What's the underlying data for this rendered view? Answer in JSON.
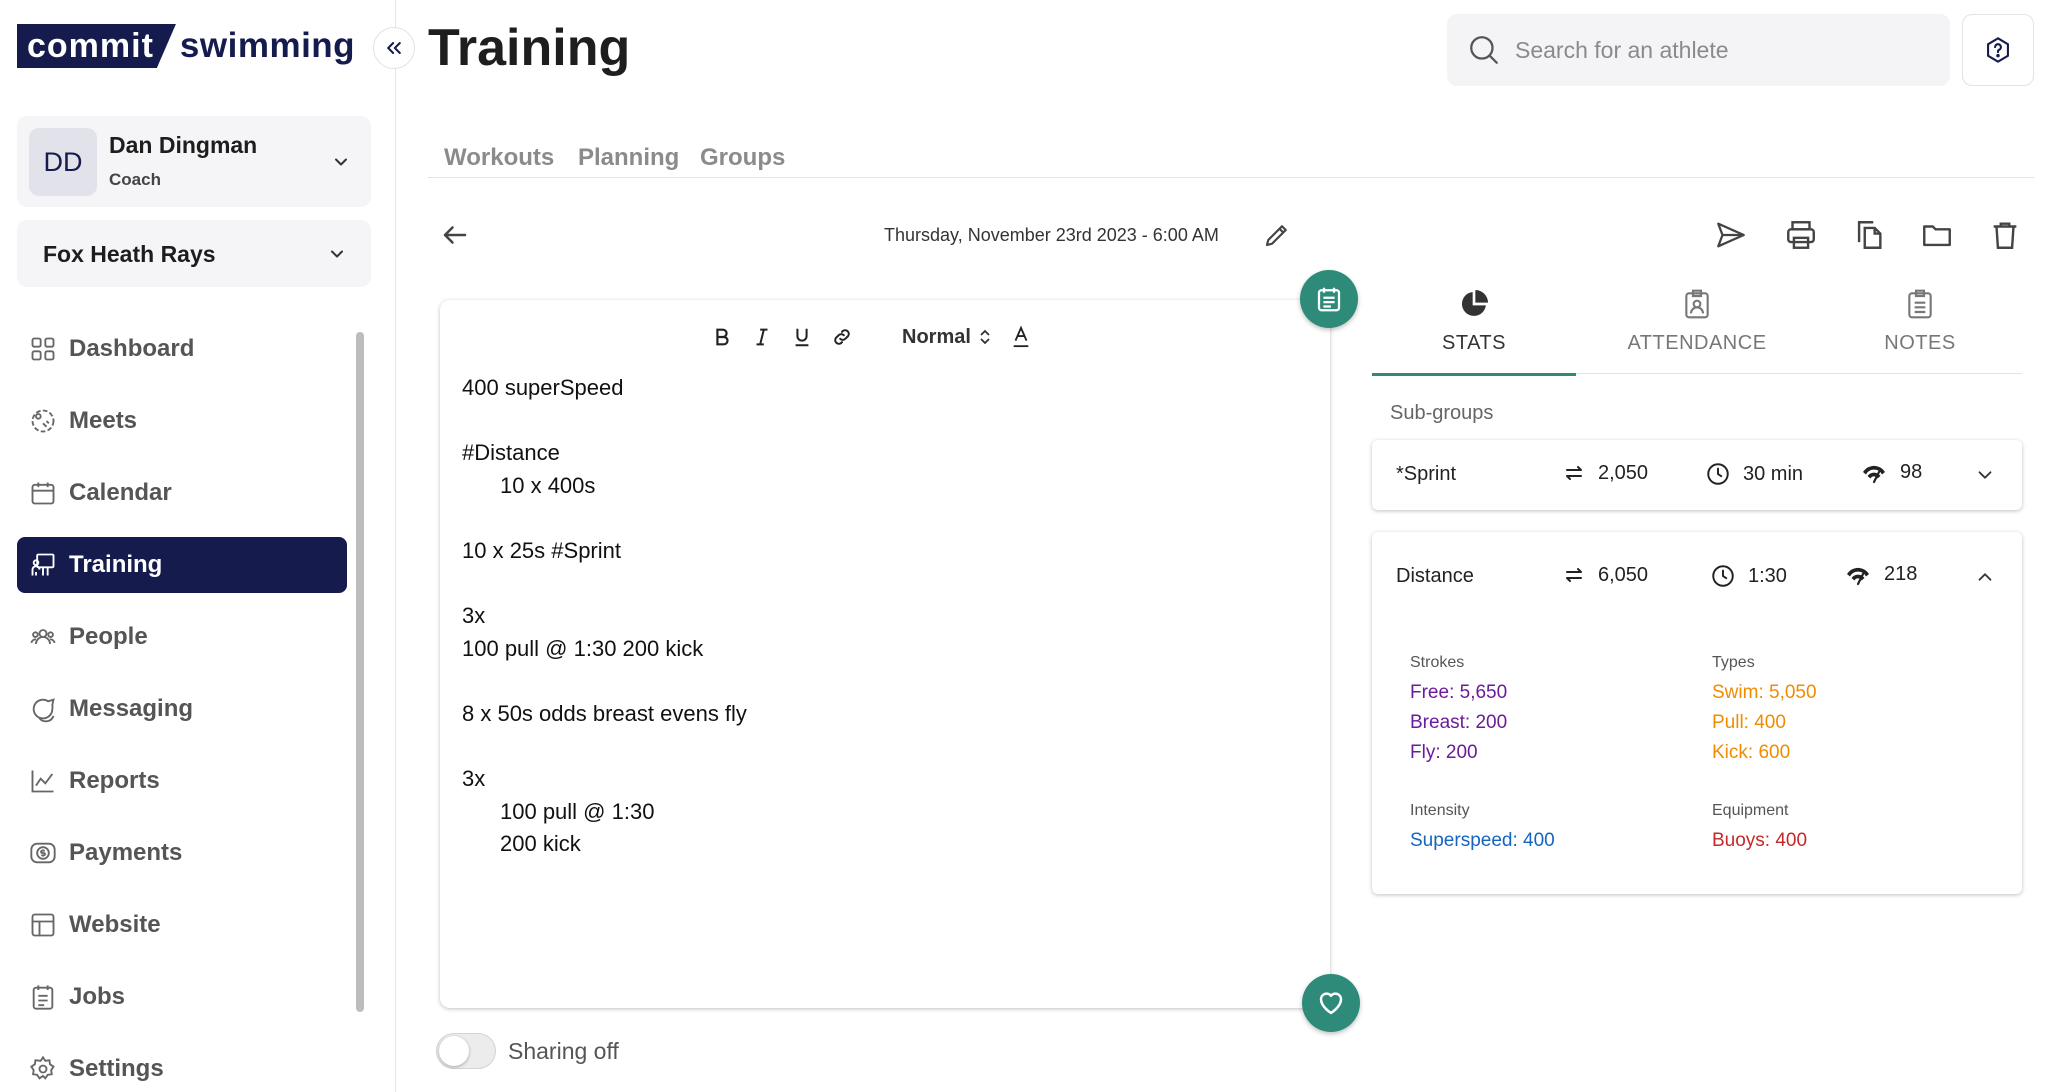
{
  "app": {
    "logo_left": "commit",
    "logo_right": "swimming",
    "page_title": "Training"
  },
  "user": {
    "initials": "DD",
    "name": "Dan Dingman",
    "role": "Coach"
  },
  "team": {
    "name": "Fox Heath Rays"
  },
  "nav": {
    "items": [
      {
        "label": "Dashboard",
        "icon": "dashboard-icon"
      },
      {
        "label": "Meets",
        "icon": "meets-icon"
      },
      {
        "label": "Calendar",
        "icon": "calendar-icon"
      },
      {
        "label": "Training",
        "icon": "training-icon",
        "active": true
      },
      {
        "label": "People",
        "icon": "people-icon"
      },
      {
        "label": "Messaging",
        "icon": "messaging-icon"
      },
      {
        "label": "Reports",
        "icon": "reports-icon"
      },
      {
        "label": "Payments",
        "icon": "payments-icon"
      },
      {
        "label": "Website",
        "icon": "website-icon"
      },
      {
        "label": "Jobs",
        "icon": "jobs-icon"
      },
      {
        "label": "Settings",
        "icon": "settings-icon"
      }
    ]
  },
  "search": {
    "placeholder": "Search for an athlete"
  },
  "tabs": {
    "workouts": "Workouts",
    "planning": "Planning",
    "groups": "Groups"
  },
  "workout": {
    "date": "Thursday, November 23rd 2023 - 6:00 AM",
    "format_style": "Normal",
    "lines": [
      {
        "text": "400 superSpeed",
        "indent": false
      },
      {
        "text": "",
        "indent": false
      },
      {
        "text": "#Distance",
        "indent": false
      },
      {
        "text": "10 x 400s",
        "indent": true
      },
      {
        "text": "",
        "indent": false
      },
      {
        "text": "10 x 25s #Sprint",
        "indent": false
      },
      {
        "text": "",
        "indent": false
      },
      {
        "text": "3x",
        "indent": false
      },
      {
        "text": "100 pull @ 1:30 200 kick",
        "indent": false
      },
      {
        "text": "",
        "indent": false
      },
      {
        "text": "8 x 50s odds breast evens fly",
        "indent": false
      },
      {
        "text": "",
        "indent": false
      },
      {
        "text": "3x",
        "indent": false
      },
      {
        "text": "100 pull @ 1:30",
        "indent": true
      },
      {
        "text": "200 kick",
        "indent": true
      }
    ],
    "sharing_label": "Sharing off"
  },
  "right_tabs": {
    "stats": "STATS",
    "attendance": "ATTENDANCE",
    "notes": "NOTES"
  },
  "subgroups": {
    "label": "Sub-groups",
    "sprint": {
      "name": "*Sprint",
      "distance": "2,050",
      "time": "30 min",
      "intensity": "98"
    },
    "distance": {
      "name": "Distance",
      "distance": "6,050",
      "time": "1:30",
      "intensity": "218",
      "strokes_title": "Strokes",
      "strokes": [
        "Free: 5,650",
        "Breast: 200",
        "Fly: 200"
      ],
      "types_title": "Types",
      "types": [
        "Swim: 5,050",
        "Pull: 400",
        "Kick: 600"
      ],
      "intensity_title": "Intensity",
      "intensity_items": [
        "Superspeed: 400"
      ],
      "equipment_title": "Equipment",
      "equipment_items": [
        "Buoys: 400"
      ]
    }
  },
  "colors": {
    "brand": "#151b4d",
    "accent": "#2e8b7a",
    "strokes": "#6a1b9a",
    "types": "#ef8c00",
    "intensity": "#1565c0",
    "equipment": "#c62828"
  }
}
